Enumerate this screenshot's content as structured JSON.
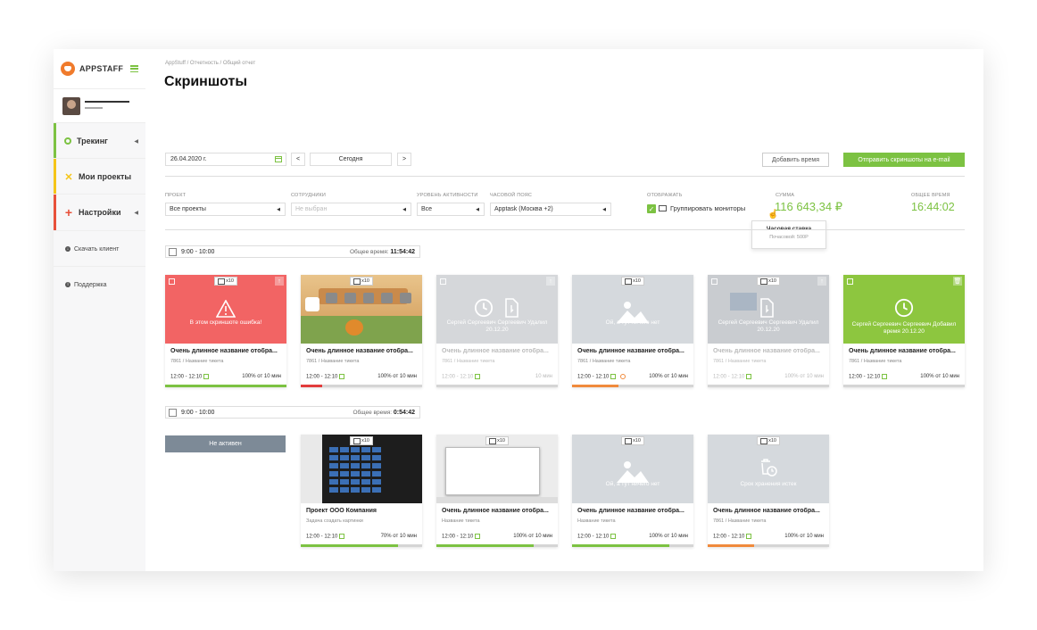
{
  "brand": {
    "name": "APPSTAFF"
  },
  "sidebar": {
    "items": [
      {
        "label": "Трекинг",
        "color": "#7cc242"
      },
      {
        "label": "Мои проекты",
        "color": "#f5c518"
      },
      {
        "label": "Настройки",
        "color": "#e8503a"
      }
    ],
    "links": [
      {
        "label": "Скачать клиент"
      },
      {
        "label": "Поддержка"
      }
    ]
  },
  "header": {
    "breadcrumb": "AppStuff / Отчетность / Общий отчет",
    "title": "Скриншоты"
  },
  "toolbar": {
    "date": "26.04.2020 г.",
    "prev": "<",
    "today": "Сегодня",
    "next": ">",
    "add_time": "Добавить время",
    "send": "Отправить скриншоты на e-mail"
  },
  "filters": {
    "project": {
      "label": "ПРОЕКТ",
      "value": "Все проекты"
    },
    "employees": {
      "label": "СОТРУДНИКИ",
      "placeholder": "Не выбран"
    },
    "activity": {
      "label": "УРОВЕНЬ АКТИВНОСТИ",
      "value": "Все"
    },
    "timezone": {
      "label": "ЧАСОВОЙ ПОЯС",
      "value": "Apptask (Москва +2)"
    },
    "display": {
      "label": "ОТОБРАЖАТЬ",
      "option": "Группировать мониторы",
      "checked": true
    },
    "sum": {
      "label": "СУММА",
      "value": "116 643,34 ₽"
    },
    "total": {
      "label": "ОБЩЕЕ ВРЕМЯ",
      "value": "16:44:02"
    }
  },
  "tooltip": {
    "title": "Часовая ставка",
    "text": "Почасовой: 500Р"
  },
  "groups": [
    {
      "range": "9:00 - 10:00",
      "total_label": "Общее время:",
      "total": "11:54:42",
      "cards": [
        {
          "type": "error",
          "badge": "x10",
          "overlay": "В этом скриншоте ошибка!",
          "name": "Очень длинное название отобра...",
          "sub": "7861 / Название тикета",
          "time": "12:00 - 12:10",
          "activity": "100% от 10 мин",
          "progress": 1.0,
          "bar": "#7cc242"
        },
        {
          "type": "game",
          "badge": "x10",
          "name": "Очень длинное название отобра...",
          "sub": "7861 / Название тикета",
          "time": "12:00 - 12:10",
          "activity": "100% от 10 мин",
          "progress": 0.18,
          "bar": "#e23c3c"
        },
        {
          "type": "deleted",
          "overlay": "Сергей Сергеевич Сергеевич Удалил 20.12.20",
          "name": "Очень длинное название отобра...",
          "sub": "7861 / Название тикета",
          "time": "12:00 - 12:10",
          "activity": "10 мин",
          "progress": 0,
          "bar": "#d5d5d5"
        },
        {
          "type": "empty",
          "badge": "x10",
          "overlay": "Ой, а тут ничего нет",
          "name": "Очень длинное название отобра...",
          "sub": "7861 / Название тикета",
          "time": "12:00 - 12:10",
          "activity": "100% от 10 мин",
          "progress": 0.38,
          "bar": "#f08a3c"
        },
        {
          "type": "deleted2",
          "badge": "x10",
          "overlay": "Сергей Сергеевич Сергеевич Удалил 20.12.20",
          "name": "Очень длинное название отобра...",
          "sub": "7861 / Название тикета",
          "time": "12:00 - 12:10",
          "activity": "100% от 10 мин",
          "progress": 0,
          "bar": "#d5d5d5"
        },
        {
          "type": "added",
          "overlay": "Сергей Сергеевич Сергеевич Добавил время 20.12.20",
          "name": "Очень длинное название отобра...",
          "sub": "7861 / Название тикета",
          "time": "12:00 - 12:10",
          "activity": "100% от 10 мин",
          "progress": 0,
          "bar": "#d5d5d5"
        }
      ]
    },
    {
      "range": "9:00 - 10:00",
      "total_label": "Общее время:",
      "total": "0:54:42",
      "inactive": "Не активен",
      "cards": [
        {
          "type": "calc",
          "badge": "x10",
          "name": "Проект ООО Компания",
          "sub": "Задача создать картинки",
          "time": "12:00 - 12:10",
          "activity": "70% от 10 мин",
          "progress": 0.8,
          "bar": "#7cc242"
        },
        {
          "type": "window",
          "badge": "x10",
          "name": "Очень длинное название отобра...",
          "sub": "Название тикета",
          "time": "12:00 - 12:10",
          "activity": "100% от 10 мин",
          "progress": 0.8,
          "bar": "#7cc242"
        },
        {
          "type": "empty",
          "badge": "x10",
          "overlay": "Ой, а тут ничего нет",
          "name": "Очень длинное название отобра...",
          "sub": "Название тикета",
          "time": "12:00 - 12:10",
          "activity": "100% от 10 мин",
          "progress": 0.8,
          "bar": "#7cc242"
        },
        {
          "type": "expired",
          "badge": "x10",
          "overlay": "Срок хранения истек",
          "name": "Очень длинное название отобра...",
          "sub": "7861 / Название тикета",
          "time": "12:00 - 12:10",
          "activity": "100% от 10 мин",
          "progress": 0.38,
          "bar": "#f08a3c"
        }
      ]
    }
  ]
}
